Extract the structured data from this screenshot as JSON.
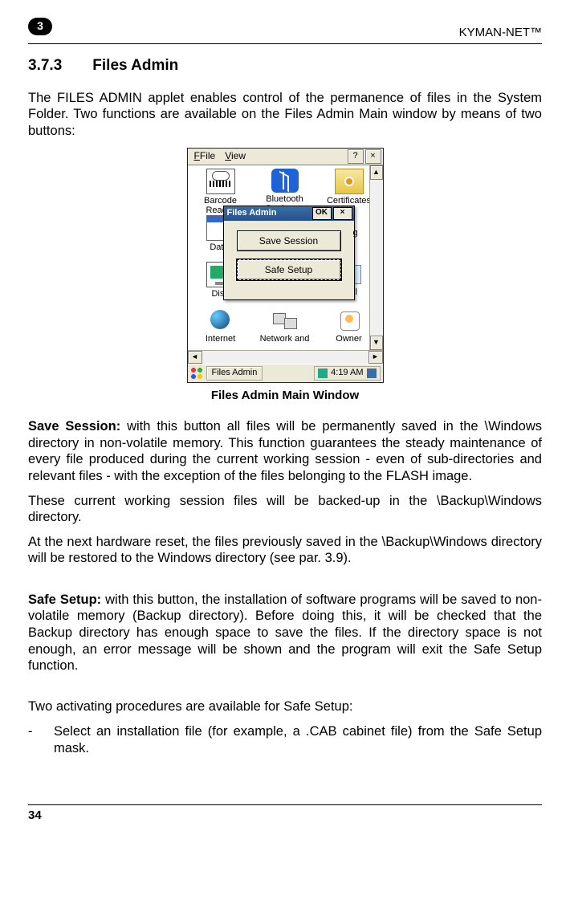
{
  "header": {
    "chapter_number": "3",
    "product": "KYMAN-NET™"
  },
  "section": {
    "number": "3.7.3",
    "title": "Files Admin"
  },
  "intro": "The FILES ADMIN applet enables control of the permanence of files in the System Folder. Two functions are available on the Files Admin Main window by means of two buttons:",
  "figure": {
    "caption": "Files Admin Main Window",
    "menubar": {
      "file": "File",
      "view": "View",
      "help": "?",
      "close": "×"
    },
    "dialog": {
      "title": "Files Admin",
      "ok": "OK",
      "close": "×",
      "btn_save": "Save Session",
      "btn_safe": "Safe Setup"
    },
    "icons": {
      "barcode": "Barcode Reader",
      "bluetooth": "Bluetooth Device ...",
      "certificates": "Certificates",
      "date": "Date/",
      "date_suffix": "g",
      "display": "Disp",
      "panel_suffix": "anel",
      "internet": "Internet",
      "network": "Network and",
      "owner": "Owner"
    },
    "taskbar": {
      "task": "Files Admin",
      "time": "4:19 AM"
    }
  },
  "save_session": {
    "label": "Save Session:",
    "p1": " with this button all files will be permanently saved in the \\Windows directory in non-volatile memory. This function guarantees the steady maintenance of every file produced during the current working session - even of sub-directories and relevant files - with the exception of the files belonging to the FLASH image.",
    "p2": "These current working session files will be backed-up in the \\Backup\\Windows directory.",
    "p3": "At the next hardware reset, the files previously saved in the \\Backup\\Windows directory will be restored to the Windows directory (see par. 3.9)."
  },
  "safe_setup": {
    "label": "Safe Setup:",
    "p1": " with this button, the installation of software programs will be saved to non-volatile memory (Backup directory). Before doing this, it will be checked that the Backup directory has enough space to save the files. If the directory space is not enough, an error message will be shown and the program will exit the Safe Setup function."
  },
  "procedures_intro": "Two activating procedures are available for Safe Setup:",
  "bullets": [
    "Select an installation file (for example, a .CAB cabinet file) from the Safe Setup mask."
  ],
  "footer": {
    "page": "34"
  }
}
